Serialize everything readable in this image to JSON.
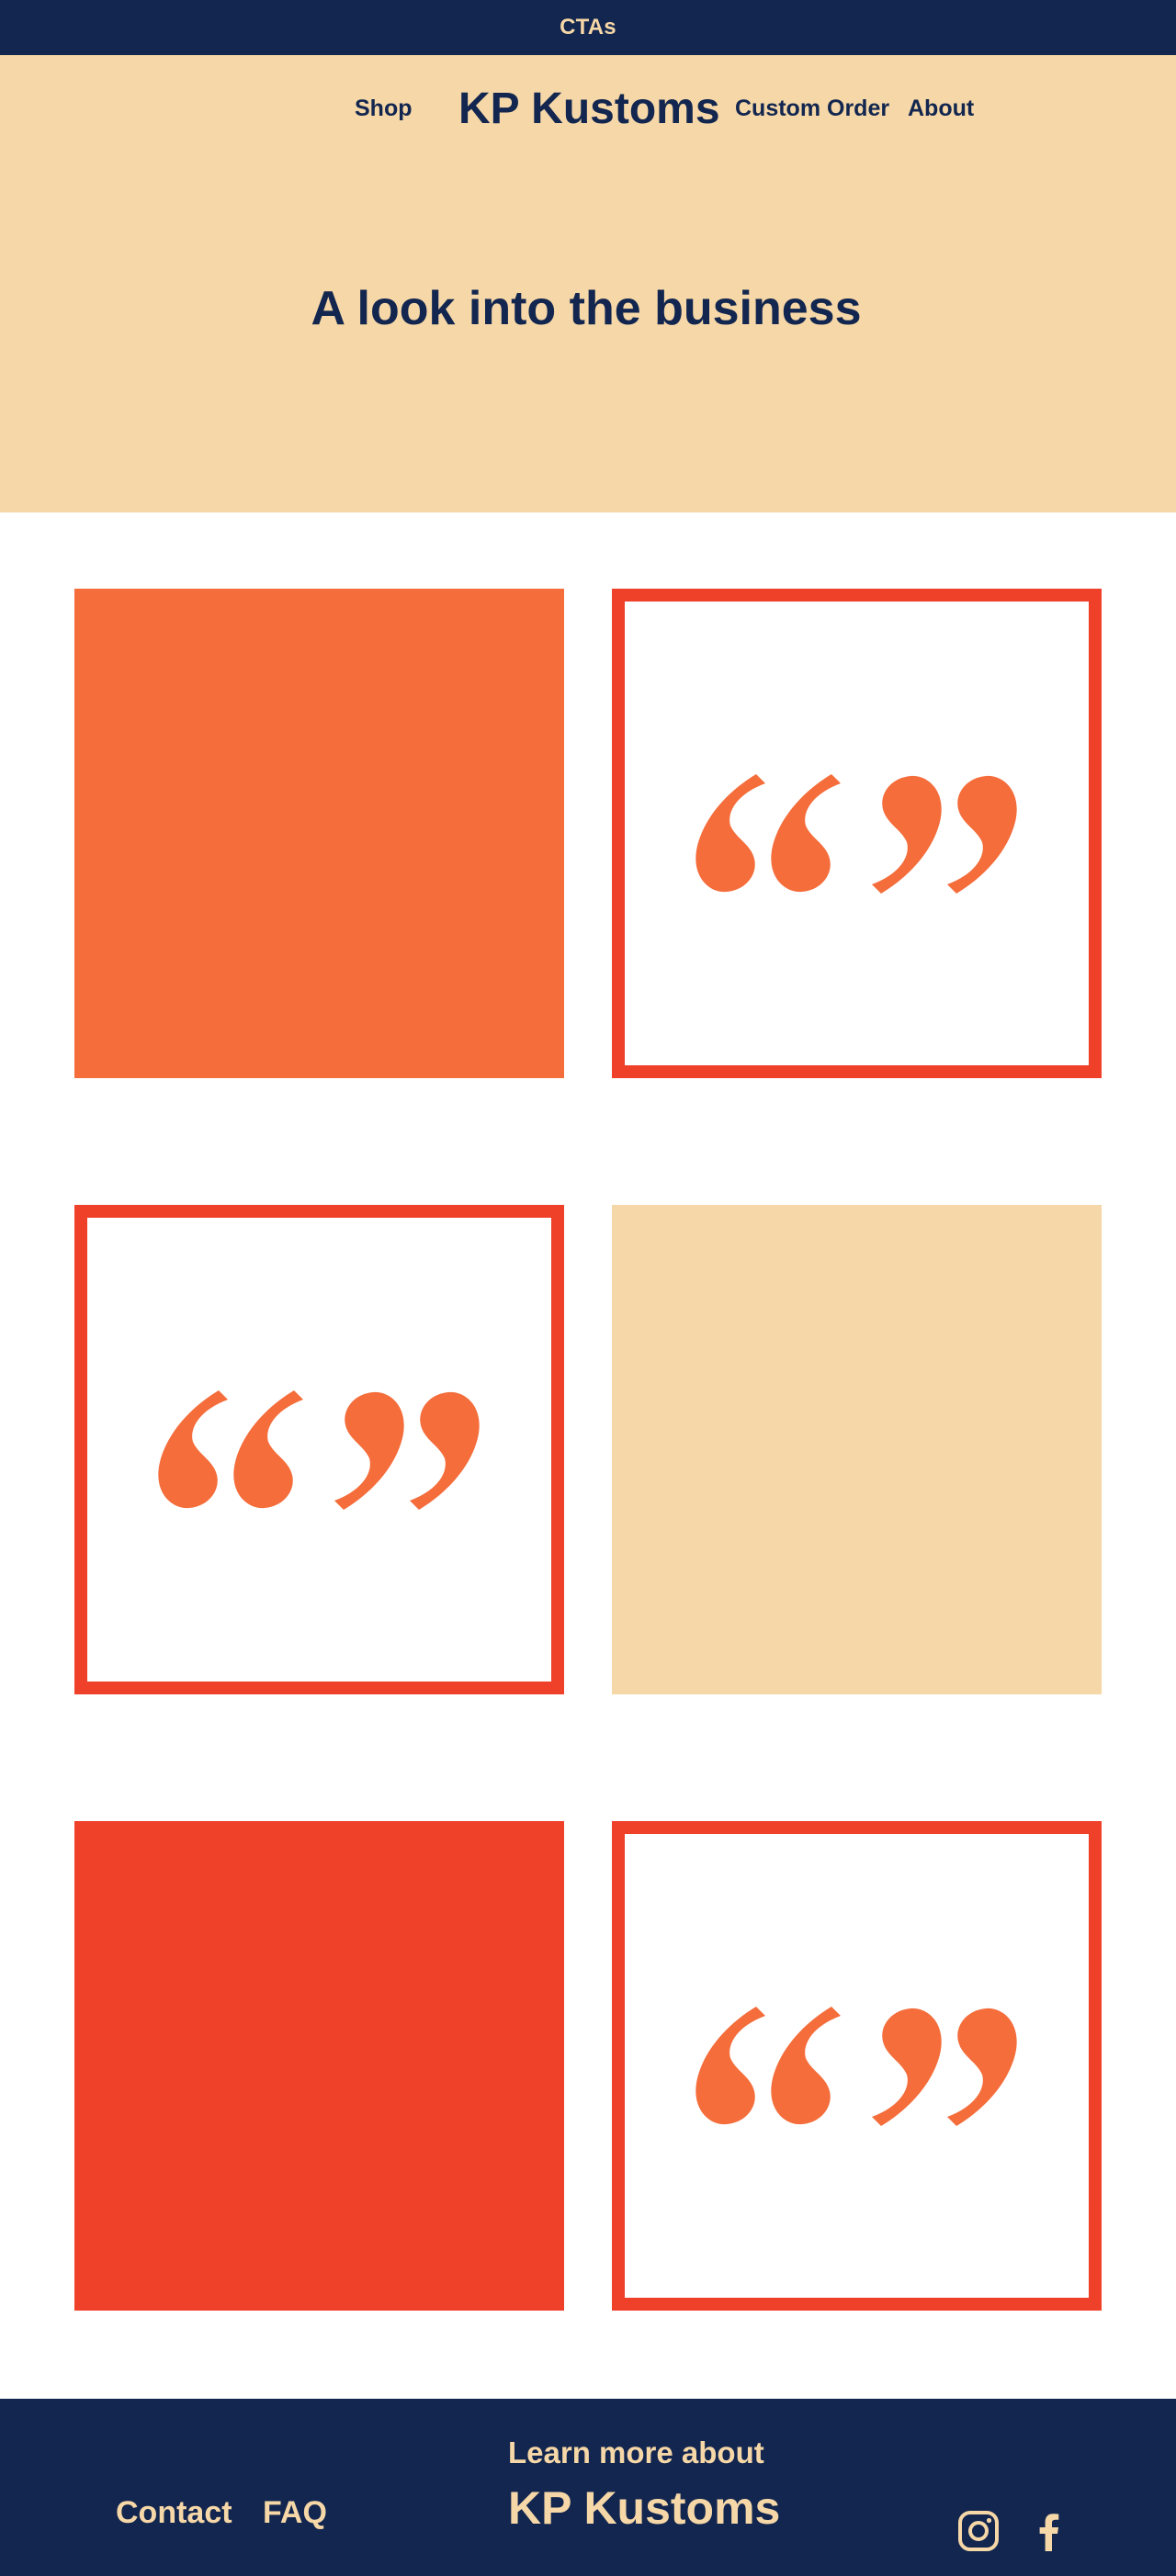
{
  "topbar": {
    "label": "CTAs"
  },
  "nav": {
    "shop": "Shop",
    "brand": "KP Kustoms",
    "custom_order": "Custom Order",
    "about": "About"
  },
  "hero": {
    "title": "A look into the business"
  },
  "gallery": {
    "tiles": [
      {
        "kind": "color",
        "color": "#f46d3b"
      },
      {
        "kind": "quote",
        "icon": "quote-icon",
        "color": "#f46d3b",
        "border": "#ef402a"
      },
      {
        "kind": "quote",
        "icon": "quote-icon",
        "color": "#f46d3b",
        "border": "#ef402a"
      },
      {
        "kind": "color",
        "color": "#f6d7a7"
      },
      {
        "kind": "color",
        "color": "#ef402a"
      },
      {
        "kind": "quote",
        "icon": "quote-icon",
        "color": "#f46d3b",
        "border": "#ef402a"
      }
    ]
  },
  "footer": {
    "contact": "Contact",
    "faq": "FAQ",
    "tagline": "Learn more about",
    "brand": "KP Kustoms",
    "social": [
      "instagram-icon",
      "facebook-icon"
    ]
  },
  "colors": {
    "navy": "#12264f",
    "peach": "#f6d7a7",
    "orange": "#f46d3b",
    "red": "#ef402a"
  }
}
